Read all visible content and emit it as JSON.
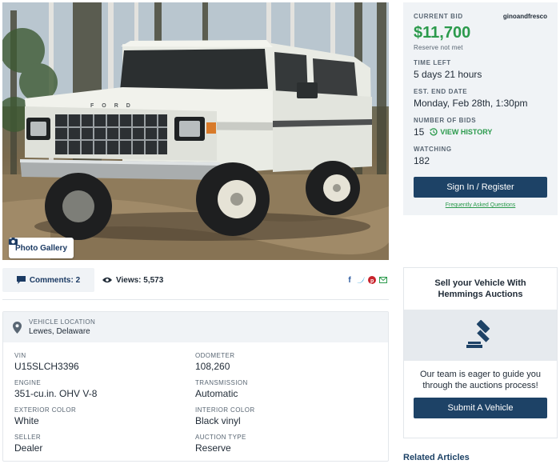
{
  "gallery": {
    "label": "Photo Gallery"
  },
  "stats": {
    "comments_label": "Comments: 2",
    "views_label": "Views: 5,573"
  },
  "location": {
    "label": "VEHICLE LOCATION",
    "value": "Lewes, Delaware"
  },
  "specs": [
    {
      "label": "VIN",
      "value": "U15SLCH3396"
    },
    {
      "label": "ODOMETER",
      "value": "108,260"
    },
    {
      "label": "ENGINE",
      "value": "351-cu.in. OHV V-8"
    },
    {
      "label": "TRANSMISSION",
      "value": "Automatic"
    },
    {
      "label": "EXTERIOR COLOR",
      "value": "White"
    },
    {
      "label": "INTERIOR COLOR",
      "value": "Black vinyl"
    },
    {
      "label": "SELLER",
      "value": "Dealer"
    },
    {
      "label": "AUCTION TYPE",
      "value": "Reserve"
    }
  ],
  "bid": {
    "current_label": "CURRENT BID",
    "seller_username": "ginoandfresco",
    "amount": "$11,700",
    "reserve_status": "Reserve not met",
    "time_left_label": "TIME LEFT",
    "time_left": "5 days 21 hours",
    "end_date_label": "EST. END DATE",
    "end_date": "Monday, Feb 28th, 1:30pm",
    "num_bids_label": "NUMBER OF BIDS",
    "num_bids": "15",
    "history_label": "VIEW HISTORY",
    "watching_label": "WATCHING",
    "watching": "182",
    "signin_label": "Sign In / Register",
    "faq_label": "Frequently Asked Questions"
  },
  "sell": {
    "title": "Sell your Vehicle With Hemmings Auctions",
    "text": "Our team is eager to guide you through the auctions process!",
    "button_label": "Submit A Vehicle"
  },
  "related": {
    "heading": "Related Articles"
  },
  "truck": {
    "grille_lettering": "FORD"
  },
  "colors": {
    "accent_green": "#2b9a4c",
    "primary_navy": "#1d4266",
    "panel_bg": "#f0f3f6"
  },
  "icons": {
    "gallery": "camera-icon",
    "comments": "comment-icon",
    "views": "eye-icon",
    "share": [
      "facebook-icon",
      "twitter-icon",
      "pinterest-icon",
      "email-icon"
    ],
    "location": "map-pin-icon",
    "history": "history-icon",
    "gavel": "gavel-icon"
  }
}
